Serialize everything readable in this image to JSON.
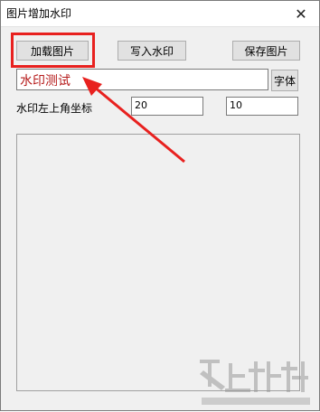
{
  "window": {
    "title": "图片增加水印",
    "close_glyph": "✕"
  },
  "toolbar": {
    "load_label": "加载图片",
    "write_label": "写入水印",
    "save_label": "保存图片"
  },
  "watermark": {
    "text_value": "水印测试",
    "font_button_label": "字体"
  },
  "coordinates": {
    "label": "水印左上角坐标",
    "x_value": "20",
    "y_value": "10"
  },
  "colors": {
    "highlight": "#e8211f",
    "watermark_text": "#b51a1a"
  }
}
